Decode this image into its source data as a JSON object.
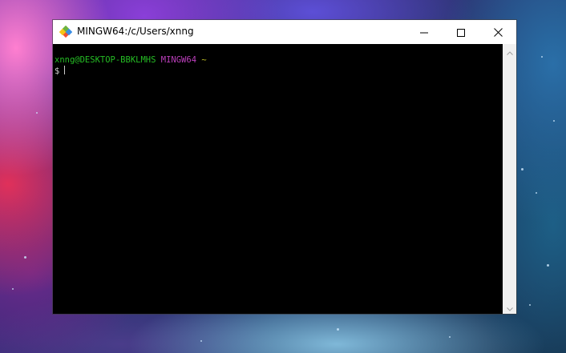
{
  "window": {
    "title": "MINGW64:/c/Users/xnng",
    "controls": {
      "minimize_icon": "minimize-icon",
      "maximize_icon": "maximize-icon",
      "close_icon": "close-icon"
    }
  },
  "terminal": {
    "prompt": {
      "user_host": "xnng@DESKTOP-BBKLMHS",
      "system": "MINGW64",
      "path": "~",
      "symbol": "$"
    },
    "colors": {
      "background": "#000000",
      "user_host": "#25bc24",
      "system": "#bc3fbc",
      "path": "#bcbc24",
      "text": "#cccccc"
    }
  },
  "scrollbar": {
    "up_icon": "scroll-up-arrow-icon",
    "down_icon": "scroll-down-arrow-icon"
  }
}
